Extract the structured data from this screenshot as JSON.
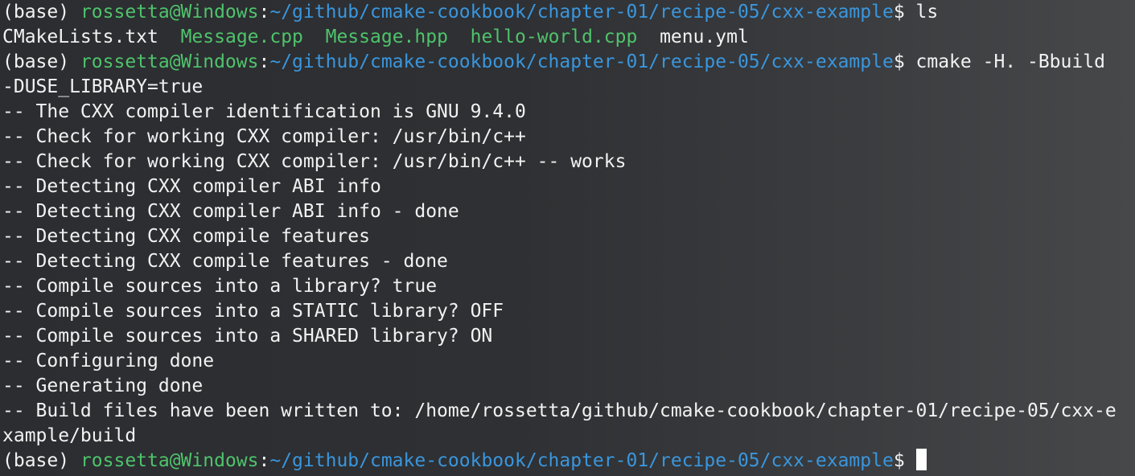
{
  "prompt": {
    "env": "(base) ",
    "user_host": "rossetta@Windows",
    "colon": ":",
    "cwd": "~/github/cmake-cookbook/chapter-01/recipe-05/cxx-example",
    "dollar": "$ "
  },
  "commands": {
    "first": "ls",
    "second": "cmake -H. -Bbuild",
    "second_wrap": "-DUSE_LIBRARY=true"
  },
  "ls_output": {
    "file1": "CMakeLists.txt",
    "file2": "Message.cpp",
    "file3": "Message.hpp",
    "file4": "hello-world.cpp",
    "file5": "menu.yml"
  },
  "cmake_output": [
    "-- The CXX compiler identification is GNU 9.4.0",
    "-- Check for working CXX compiler: /usr/bin/c++",
    "-- Check for working CXX compiler: /usr/bin/c++ -- works",
    "-- Detecting CXX compiler ABI info",
    "-- Detecting CXX compiler ABI info - done",
    "-- Detecting CXX compile features",
    "-- Detecting CXX compile features - done",
    "-- Compile sources into a library? true",
    "-- Compile sources into a STATIC library? OFF",
    "-- Compile sources into a SHARED library? ON",
    "-- Configuring done",
    "-- Generating done",
    "-- Build files have been written to: /home/rossetta/github/cmake-cookbook/chapter-01/recipe-05/cxx-e",
    "xample/build"
  ],
  "colors": {
    "user_host": "#4fc36b",
    "cwd": "#3a96dd",
    "text": "#f2f2f2",
    "source_files": "#4fc36b"
  }
}
